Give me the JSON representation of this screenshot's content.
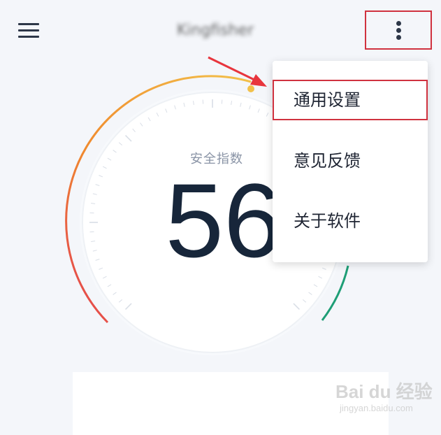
{
  "header": {
    "title": "Kingfisher",
    "menu_icon": "hamburger-icon",
    "more_icon": "more-vertical-icon"
  },
  "gauge": {
    "label": "安全指数",
    "score": "56",
    "score_fraction": 0.56,
    "colors": {
      "red": "#e23b53",
      "orange": "#f08a2e",
      "yellow": "#f2c14a",
      "green": "#1e9e76"
    }
  },
  "menu": {
    "items": [
      {
        "label": "通用设置"
      },
      {
        "label": "意见反馈"
      },
      {
        "label": "关于软件"
      }
    ]
  },
  "annotation": {
    "color": "#d0323f"
  },
  "watermark": {
    "logo": "Bai du 经验",
    "url": "jingyan.baidu.com"
  }
}
